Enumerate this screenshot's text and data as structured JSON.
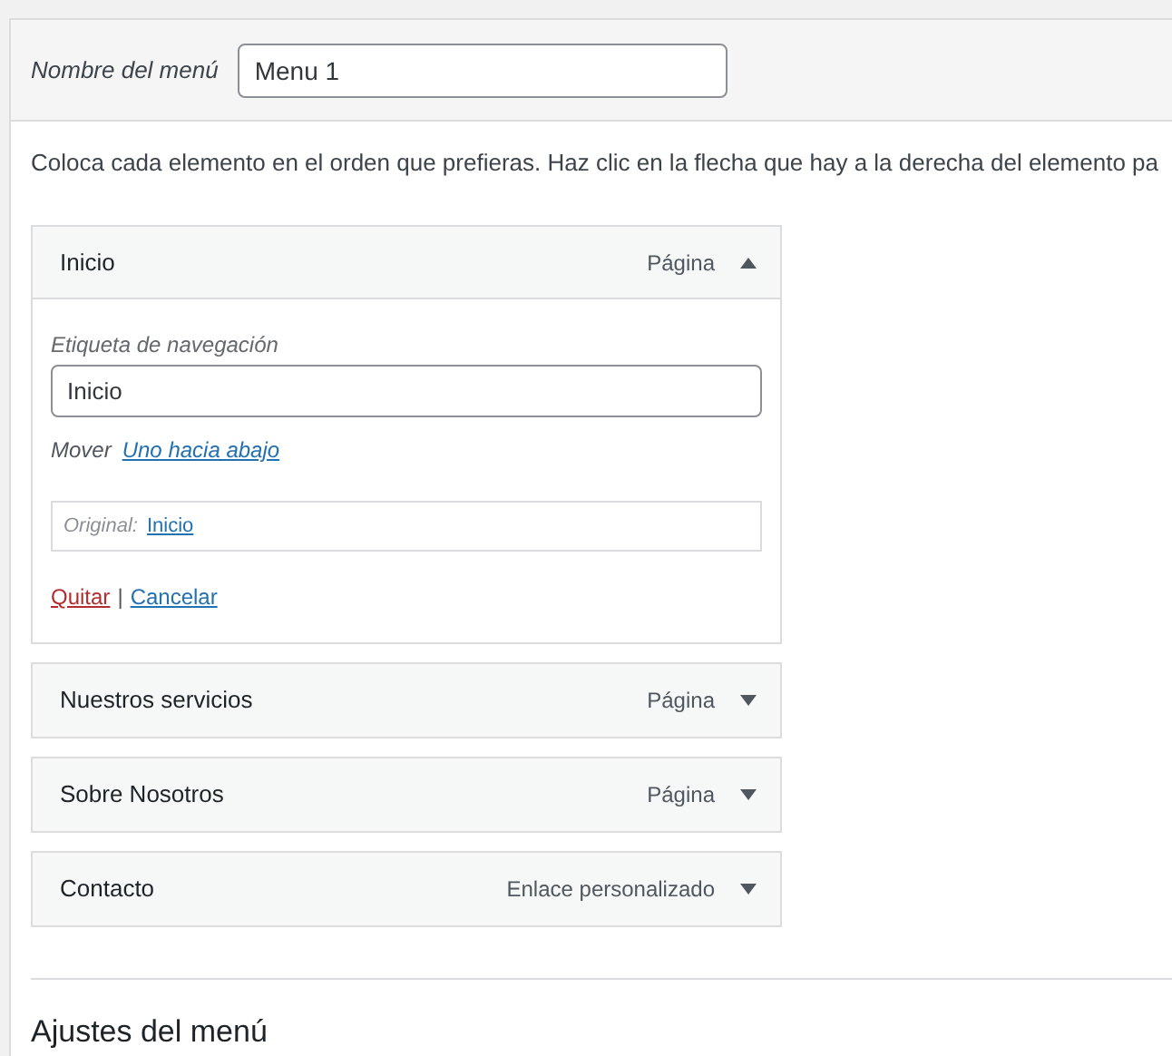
{
  "menu_name": {
    "label": "Nombre del menú",
    "value": "Menu 1"
  },
  "instructions": "Coloca cada elemento en el orden que prefieras. Haz clic en la flecha que hay a la derecha del elemento pa",
  "items": [
    {
      "title": "Inicio",
      "type": "Página",
      "expanded": true,
      "nav_label": {
        "label": "Etiqueta de navegación",
        "value": "Inicio"
      },
      "move": {
        "label": "Mover",
        "link": "Uno hacia abajo"
      },
      "original": {
        "label": "Original:",
        "link": "Inicio"
      },
      "actions": {
        "remove": "Quitar",
        "separator": "|",
        "cancel": "Cancelar"
      }
    },
    {
      "title": "Nuestros servicios",
      "type": "Página",
      "expanded": false
    },
    {
      "title": "Sobre Nosotros",
      "type": "Página",
      "expanded": false
    },
    {
      "title": "Contacto",
      "type": "Enlace personalizado",
      "expanded": false
    }
  ],
  "settings_heading": "Ajustes del menú"
}
